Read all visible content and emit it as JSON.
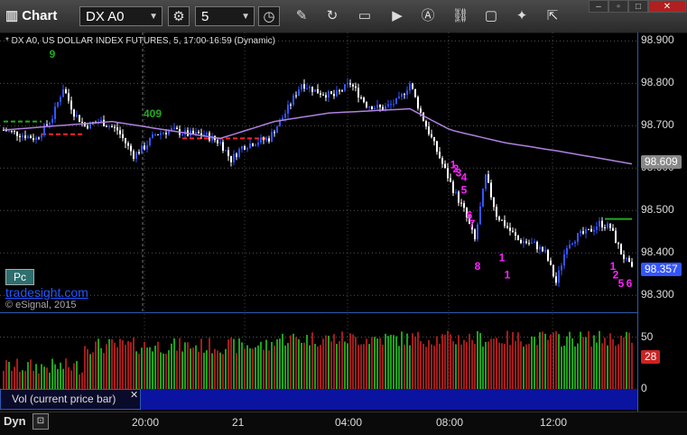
{
  "toolbar": {
    "title": "Chart",
    "symbol": "DX A0",
    "interval": "5"
  },
  "chart_title": "* DX A0, US DOLLAR INDEX FUTURES, 5, 17:00-16:59 (Dynamic)",
  "branding": {
    "pc_badge": "Pc",
    "link": "tradesight.com",
    "copyright": "© eSignal, 2015"
  },
  "volume_pane_label": "Vol (current price bar)",
  "bottom": {
    "dyn_label": "Dyn"
  },
  "colors": {
    "up_bar": "#3355ff",
    "down_bar": "#ffffff",
    "ma_line": "#b080e0",
    "seq_green": "#22aa22",
    "seq_magenta": "#ff22ff",
    "vol_up": "#22cc22",
    "vol_down": "#cc2222"
  },
  "chart_data": [
    {
      "type": "candlestick",
      "title": "* DX A0, US DOLLAR INDEX FUTURES, 5, 17:00-16:59 (Dynamic)",
      "ylim": [
        98.26,
        98.92
      ],
      "y_ticks": [
        98.9,
        98.8,
        98.7,
        98.6,
        98.5,
        98.4,
        98.3
      ],
      "y_tick_labels": [
        "98.900",
        "98.800",
        "98.700",
        "98.600",
        "98.500",
        "98.400",
        "98.300"
      ],
      "x_ticks": [
        "20:00",
        "21",
        "04:00",
        "08:00",
        "12:00"
      ],
      "last_price": "98.357",
      "ma_last": "98.609",
      "price_path": [
        [
          0,
          98.69
        ],
        [
          6,
          98.68
        ],
        [
          12,
          98.67
        ],
        [
          18,
          98.72
        ],
        [
          22,
          98.79
        ],
        [
          26,
          98.73
        ],
        [
          30,
          98.7
        ],
        [
          36,
          98.71
        ],
        [
          42,
          98.69
        ],
        [
          48,
          98.63
        ],
        [
          52,
          98.65
        ],
        [
          56,
          98.68
        ],
        [
          62,
          98.69
        ],
        [
          68,
          98.68
        ],
        [
          74,
          98.68
        ],
        [
          80,
          98.66
        ],
        [
          84,
          98.62
        ],
        [
          88,
          98.65
        ],
        [
          92,
          98.66
        ],
        [
          98,
          98.67
        ],
        [
          104,
          98.73
        ],
        [
          110,
          98.8
        ],
        [
          116,
          98.78
        ],
        [
          122,
          98.77
        ],
        [
          128,
          98.8
        ],
        [
          134,
          98.75
        ],
        [
          140,
          98.74
        ],
        [
          146,
          98.76
        ],
        [
          150,
          98.8
        ],
        [
          154,
          98.73
        ],
        [
          158,
          98.67
        ],
        [
          162,
          98.61
        ],
        [
          166,
          98.55
        ],
        [
          170,
          98.5
        ],
        [
          174,
          98.43
        ],
        [
          178,
          98.58
        ],
        [
          182,
          98.49
        ],
        [
          186,
          98.46
        ],
        [
          190,
          98.43
        ],
        [
          196,
          98.42
        ],
        [
          200,
          98.4
        ],
        [
          204,
          98.33
        ],
        [
          208,
          98.42
        ],
        [
          212,
          98.44
        ],
        [
          216,
          98.45
        ],
        [
          220,
          98.47
        ],
        [
          224,
          98.46
        ],
        [
          228,
          98.4
        ],
        [
          232,
          98.36
        ]
      ],
      "moving_average": [
        [
          0,
          98.69
        ],
        [
          20,
          98.7
        ],
        [
          40,
          98.71
        ],
        [
          60,
          98.69
        ],
        [
          80,
          98.67
        ],
        [
          100,
          98.71
        ],
        [
          120,
          98.73
        ],
        [
          150,
          98.74
        ],
        [
          165,
          98.69
        ],
        [
          185,
          98.66
        ],
        [
          205,
          98.64
        ],
        [
          232,
          98.61
        ]
      ],
      "annotations": [
        {
          "text": "9",
          "color": "green",
          "x": 18,
          "y": 98.86
        },
        {
          "text": "409",
          "color": "green",
          "x": 55,
          "y": 98.72
        },
        {
          "text": "1",
          "color": "magenta",
          "x": 166,
          "y": 98.6
        },
        {
          "text": "2",
          "color": "magenta",
          "x": 167,
          "y": 98.59
        },
        {
          "text": "3",
          "color": "magenta",
          "x": 168,
          "y": 98.58
        },
        {
          "text": "4",
          "color": "magenta",
          "x": 170,
          "y": 98.57
        },
        {
          "text": "5",
          "color": "magenta",
          "x": 170,
          "y": 98.54
        },
        {
          "text": "6",
          "color": "magenta",
          "x": 172,
          "y": 98.48
        },
        {
          "text": "7",
          "color": "magenta",
          "x": 173,
          "y": 98.46
        },
        {
          "text": "8",
          "color": "magenta",
          "x": 175,
          "y": 98.36
        },
        {
          "text": "1",
          "color": "magenta",
          "x": 184,
          "y": 98.38
        },
        {
          "text": "1",
          "color": "magenta",
          "x": 186,
          "y": 98.34
        },
        {
          "text": "1",
          "color": "magenta",
          "x": 225,
          "y": 98.36
        },
        {
          "text": "2",
          "color": "magenta",
          "x": 226,
          "y": 98.34
        },
        {
          "text": "5",
          "color": "magenta",
          "x": 228,
          "y": 98.32
        },
        {
          "text": "6",
          "color": "magenta",
          "x": 231,
          "y": 98.32
        }
      ],
      "levels": [
        {
          "y": 98.71,
          "x_start": 0,
          "x_end": 14,
          "color": "green",
          "dashed": true
        },
        {
          "y": 98.68,
          "x_start": 14,
          "x_end": 30,
          "color": "red",
          "dashed": true
        },
        {
          "y": 98.67,
          "x_start": 66,
          "x_end": 98,
          "color": "red",
          "dashed": true
        },
        {
          "y": 98.48,
          "x_start": 222,
          "x_end": 232,
          "color": "green",
          "dashed": false
        }
      ]
    },
    {
      "type": "bar",
      "title": "Vol (current price bar)",
      "ylim": [
        0,
        60
      ],
      "y_ticks": [
        50,
        0
      ],
      "y_tick_labels": [
        "50",
        "0"
      ],
      "last_value": "28"
    }
  ]
}
